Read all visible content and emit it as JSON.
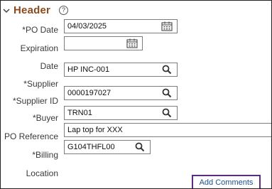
{
  "section": {
    "title": "Header",
    "help_glyph": "?"
  },
  "labels": {
    "po_date": "*PO Date",
    "expiration": "Expiration",
    "date": "Date",
    "supplier": "*Supplier",
    "supplier_id": "*Supplier ID",
    "buyer": "*Buyer",
    "po_reference": "PO Reference",
    "billing": "*Billing",
    "location": "Location"
  },
  "fields": {
    "po_date": "04/03/2025",
    "expiration": "",
    "supplier": "HP INC-001",
    "supplier_id": "0000197027",
    "buyer": "TRN01",
    "po_reference": "Lap top for XXX",
    "billing_location": "G104THFL00"
  },
  "buttons": {
    "add_comments": "Add Comments"
  },
  "colors": {
    "header_title": "#8b4a1c",
    "button_border": "#5a2d82",
    "link": "#1f4e8c"
  }
}
